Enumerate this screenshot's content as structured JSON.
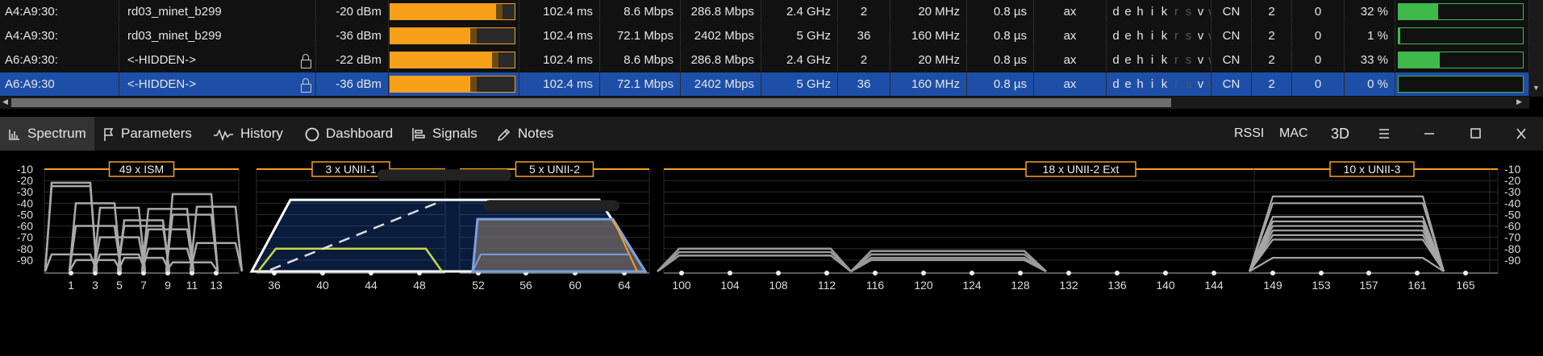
{
  "table": {
    "rows": [
      {
        "mac": "A4:A9:30:",
        "ssid": "rd03_minet_b299",
        "locked": false,
        "rssi": "-20 dBm",
        "signal": 0.85,
        "beacon": "102.4 ms",
        "min_rate": "8.6 Mbps",
        "max_rate": "286.8 Mbps",
        "band": "2.4 GHz",
        "channel": "2",
        "width": "20 MHz",
        "gi": "0.8 µs",
        "mode": "ax",
        "country": "CN",
        "col_a": "2",
        "col_b": "0",
        "util": "32 %",
        "util_value": 0.32,
        "selected": false
      },
      {
        "mac": "A4:A9:30:",
        "ssid": "rd03_minet_b299",
        "locked": false,
        "rssi": "-36 dBm",
        "signal": 0.64,
        "beacon": "102.4 ms",
        "min_rate": "72.1 Mbps",
        "max_rate": "2402 Mbps",
        "band": "5 GHz",
        "channel": "36",
        "width": "160 MHz",
        "gi": "0.8 µs",
        "mode": "ax",
        "country": "CN",
        "col_a": "2",
        "col_b": "0",
        "util": "1 %",
        "util_value": 0.01,
        "selected": false
      },
      {
        "mac": "A6:A9:30:",
        "ssid": "<-HIDDEN->",
        "locked": true,
        "rssi": "-22 dBm",
        "signal": 0.82,
        "beacon": "102.4 ms",
        "min_rate": "8.6 Mbps",
        "max_rate": "286.8 Mbps",
        "band": "2.4 GHz",
        "channel": "2",
        "width": "20 MHz",
        "gi": "0.8 µs",
        "mode": "ax",
        "country": "CN",
        "col_a": "2",
        "col_b": "0",
        "util": "33 %",
        "util_value": 0.33,
        "selected": false
      },
      {
        "mac": "A6:A9:30",
        "ssid": "<-HIDDEN->",
        "locked": true,
        "rssi": "-36 dBm",
        "signal": 0.64,
        "beacon": "102.4 ms",
        "min_rate": "72.1 Mbps",
        "max_rate": "2402 Mbps",
        "band": "5 GHz",
        "channel": "36",
        "width": "160 MHz",
        "gi": "0.8 µs",
        "mode": "ax",
        "country": "CN",
        "col_a": "2",
        "col_b": "0",
        "util": "0 %",
        "util_value": 0.0,
        "selected": true
      }
    ],
    "flags": [
      {
        "t": "d",
        "on": true
      },
      {
        "t": "e",
        "on": true
      },
      {
        "t": "h",
        "on": true
      },
      {
        "t": "i",
        "on": true
      },
      {
        "t": "k",
        "on": true
      },
      {
        "t": "r",
        "on": false
      },
      {
        "t": "s",
        "on": false
      },
      {
        "t": "v",
        "on": true
      },
      {
        "t": "w",
        "on": false
      }
    ]
  },
  "tabs": [
    {
      "label": "Spectrum",
      "icon": "spectrum-icon",
      "active": true
    },
    {
      "label": "Parameters",
      "icon": "flag-icon",
      "active": false
    },
    {
      "label": "History",
      "icon": "pulse-icon",
      "active": false
    },
    {
      "label": "Dashboard",
      "icon": "circle-icon",
      "active": false
    },
    {
      "label": "Signals",
      "icon": "signals-icon",
      "active": false
    },
    {
      "label": "Notes",
      "icon": "pencil-icon",
      "active": false
    }
  ],
  "toolbar": {
    "rssi": "RSSI",
    "mac": "MAC",
    "three_d": "3D"
  },
  "colors": {
    "accent": "#f5a020",
    "selected": "#1e4fa8",
    "util": "#3fb94a",
    "bar": "#f7a01a"
  },
  "chart_data": [
    {
      "type": "line",
      "title": "49 x ISM",
      "x": [
        "1",
        "3",
        "5",
        "7",
        "9",
        "11",
        "13"
      ],
      "ylim": [
        -100,
        -10
      ],
      "yticks": [
        "-10",
        "-20",
        "-30",
        "-40",
        "-50",
        "-60",
        "-70",
        "-80",
        "-90"
      ]
    },
    {
      "type": "area",
      "title": "3 x UNII-1",
      "x": [
        "36",
        "40",
        "44",
        "48"
      ],
      "ylim": [
        -100,
        -10
      ],
      "series": [
        {
          "label": "rd03_minet_b299",
          "values": [
            -37,
            -37,
            -37,
            -37
          ]
        },
        {
          "values": [
            -80,
            -80,
            -80,
            -80
          ]
        }
      ]
    },
    {
      "type": "area",
      "title": "5 x UNII-2",
      "x": [
        "52",
        "56",
        "60",
        "64"
      ],
      "ylim": [
        -100,
        -10
      ]
    },
    {
      "type": "line",
      "title": "18 x UNII-2 Ext",
      "x": [
        "100",
        "104",
        "108",
        "112",
        "116",
        "120",
        "124",
        "128",
        "132",
        "136",
        "140",
        "144"
      ],
      "ylim": [
        -100,
        -10
      ]
    },
    {
      "type": "line",
      "title": "10 x UNII-3",
      "x": [
        "149",
        "153",
        "157",
        "161",
        "165"
      ],
      "ylim": [
        -100,
        -10
      ]
    }
  ]
}
